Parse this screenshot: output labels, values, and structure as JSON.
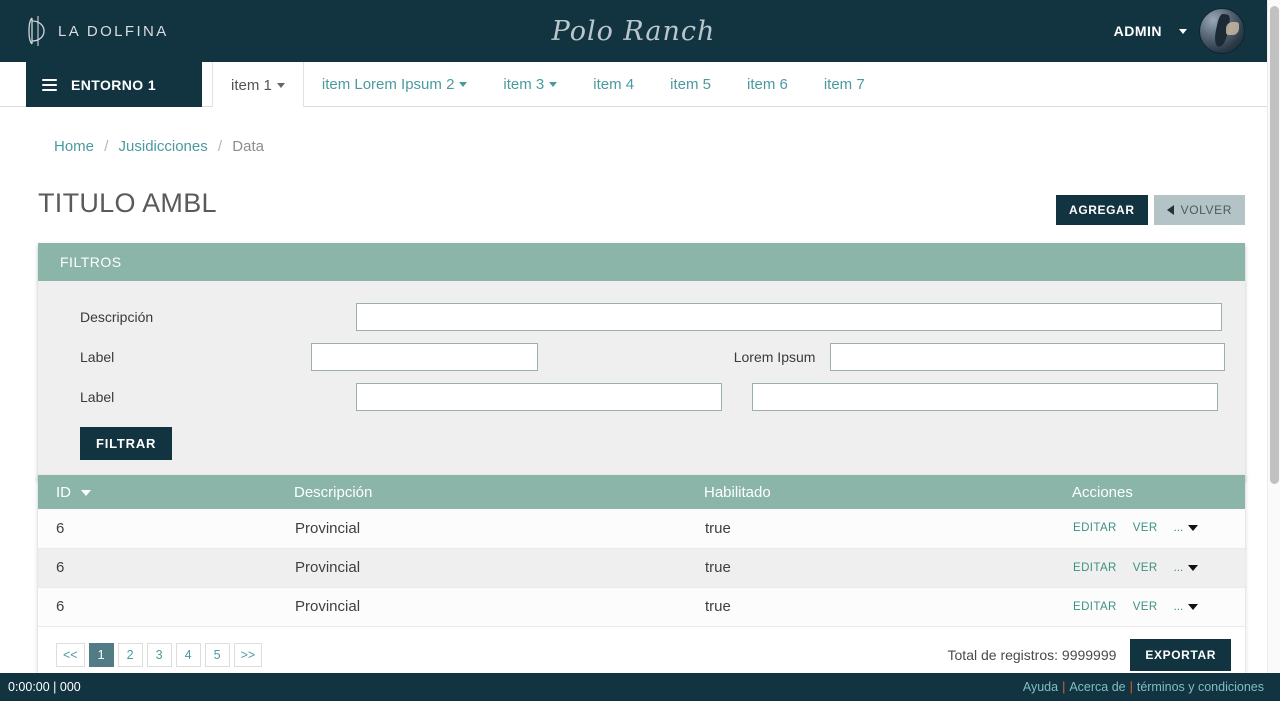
{
  "header": {
    "brand_text": "LA DOLFINA",
    "brand_mark_icon": "dolfina-monogram-icon",
    "center_logo": "Polo Ranch",
    "admin_label": "ADMIN",
    "admin_caret_icon": "chevron-down-icon",
    "avatar_icon": "user-avatar",
    "bg_color": "#123441"
  },
  "nav": {
    "entorno_label": "ENTORNO 1",
    "hamburger_icon": "hamburger-menu-icon",
    "tabs": [
      {
        "label": "item 1",
        "has_caret": true,
        "active": true
      },
      {
        "label": "item Lorem Ipsum 2",
        "has_caret": true,
        "active": false
      },
      {
        "label": "item 3",
        "has_caret": true,
        "active": false
      },
      {
        "label": "item 4",
        "has_caret": false,
        "active": false
      },
      {
        "label": "item 5",
        "has_caret": false,
        "active": false
      },
      {
        "label": "item 6",
        "has_caret": false,
        "active": false
      },
      {
        "label": "item 7",
        "has_caret": false,
        "active": false
      }
    ]
  },
  "breadcrumb": {
    "home": "Home",
    "level2": "Jusidicciones",
    "current": "Data",
    "separator": "/"
  },
  "page": {
    "title": "TITULO AMBL",
    "add_label": "AGREGAR",
    "back_label": "VOLVER",
    "back_icon": "chevron-left-icon"
  },
  "filters": {
    "panel_title": "FILTROS",
    "accent_color": "#8ab5a8",
    "rows": [
      {
        "label": "Descripción",
        "value": "",
        "placeholder": ""
      },
      {
        "label": "Label",
        "value": "",
        "placeholder": "",
        "label2": "Lorem Ipsum",
        "value2": "",
        "placeholder2": ""
      },
      {
        "label": "Label",
        "value": "",
        "placeholder": "",
        "value2": "",
        "placeholder2": ""
      }
    ],
    "submit_label": "FILTRAR"
  },
  "table": {
    "columns": [
      "ID",
      "Descripción",
      "Habilitado",
      "Acciones"
    ],
    "sort_column": "ID",
    "sort_icon": "sort-descending-caret-icon",
    "rows": [
      {
        "id": "6",
        "descripcion": "Provincial",
        "habilitado": "true"
      },
      {
        "id": "6",
        "descripcion": "Provincial",
        "habilitado": "true"
      },
      {
        "id": "6",
        "descripcion": "Provincial",
        "habilitado": "true"
      }
    ],
    "action_edit": "EDITAR",
    "action_view": "VER",
    "action_more": "...",
    "action_more_icon": "caret-down-icon"
  },
  "pagination": {
    "prev": "<<",
    "pages": [
      "1",
      "2",
      "3",
      "4",
      "5"
    ],
    "active_page": "1",
    "next": ">>",
    "total_text": "Total de registros: 9999999",
    "export_label": "EXPORTAR"
  },
  "footer": {
    "left_text": "0:00:00 | 000",
    "links": [
      "Ayuda",
      "Acerca de",
      "términos y condiciones"
    ],
    "separator": "|"
  }
}
